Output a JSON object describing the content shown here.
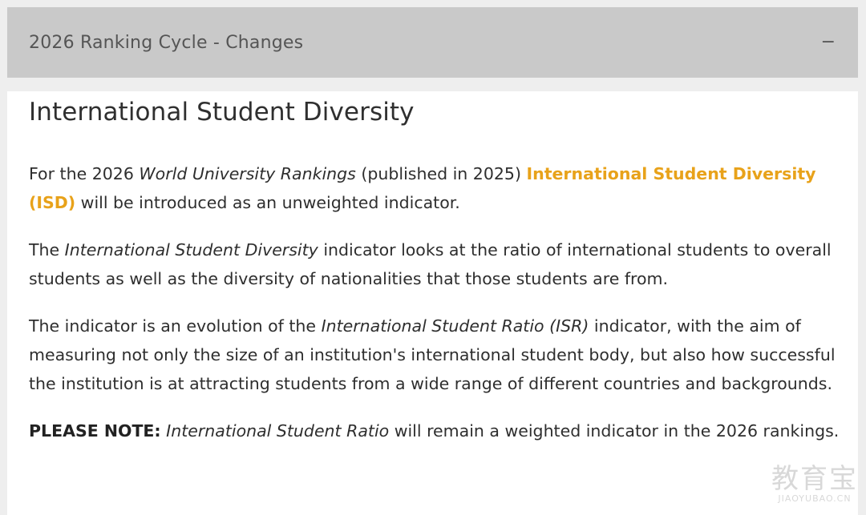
{
  "accordion": {
    "title": "2026 Ranking Cycle - Changes",
    "toggle_symbol": "−",
    "expanded": true
  },
  "section": {
    "heading": "International Student Diversity",
    "p1": {
      "t1": "For the 2026 ",
      "em1": "World University Rankings",
      "t2": " (published in 2025) ",
      "link": "International Student Diversity (ISD)",
      "t3": " will be introduced as an unweighted indicator."
    },
    "p2": {
      "t1": "The ",
      "em1": "International Student Diversity",
      "t2": " indicator looks at the ratio of international students to overall students as well as the diversity of nationalities that those students are from."
    },
    "p3": {
      "t1": "The indicator is an evolution of the ",
      "em1": "International Student Ratio (ISR)",
      "t2": " indicator, with the aim of measuring not only the size of an institution's international student body, but also how successful the institution is at attracting students from a wide range of different countries and backgrounds."
    },
    "p4": {
      "strong": "PLEASE NOTE:",
      "t1": " ",
      "em1": "International Student Ratio",
      "t2": " will remain a weighted indicator in the 2026 rankings."
    }
  },
  "watermark": {
    "cn": "教育宝",
    "en": "JIAOYUBAO.CN"
  },
  "colors": {
    "accent_link": "#e8a21a",
    "header_bg": "#c9c9c9"
  }
}
